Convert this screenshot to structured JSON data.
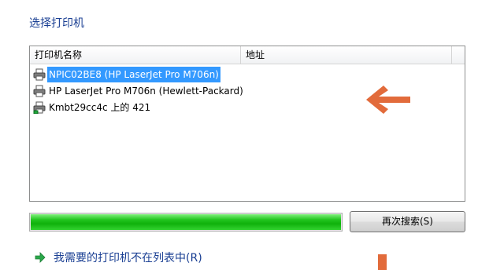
{
  "title": "选择打印机",
  "list": {
    "columns": {
      "name": "打印机名称",
      "address": "地址"
    },
    "items": [
      {
        "label": "NPIC02BE8 (HP LaserJet Pro M706n)",
        "selected": true,
        "icon": "printer-icon"
      },
      {
        "label": "HP LaserJet Pro M706n (Hewlett-Packard)",
        "selected": false,
        "icon": "printer-icon"
      },
      {
        "label": "Kmbt29cc4c 上的 421",
        "selected": false,
        "icon": "network-printer-icon"
      }
    ]
  },
  "progress": {
    "value": 1.0,
    "color": "#22c51f"
  },
  "search_again_button": "再次搜索(S)",
  "not_listed_link": "我需要的打印机不在列表中(R)",
  "colors": {
    "accent": "#1a3f93",
    "selection": "#3399ff",
    "annotation": "#e26b3b"
  }
}
